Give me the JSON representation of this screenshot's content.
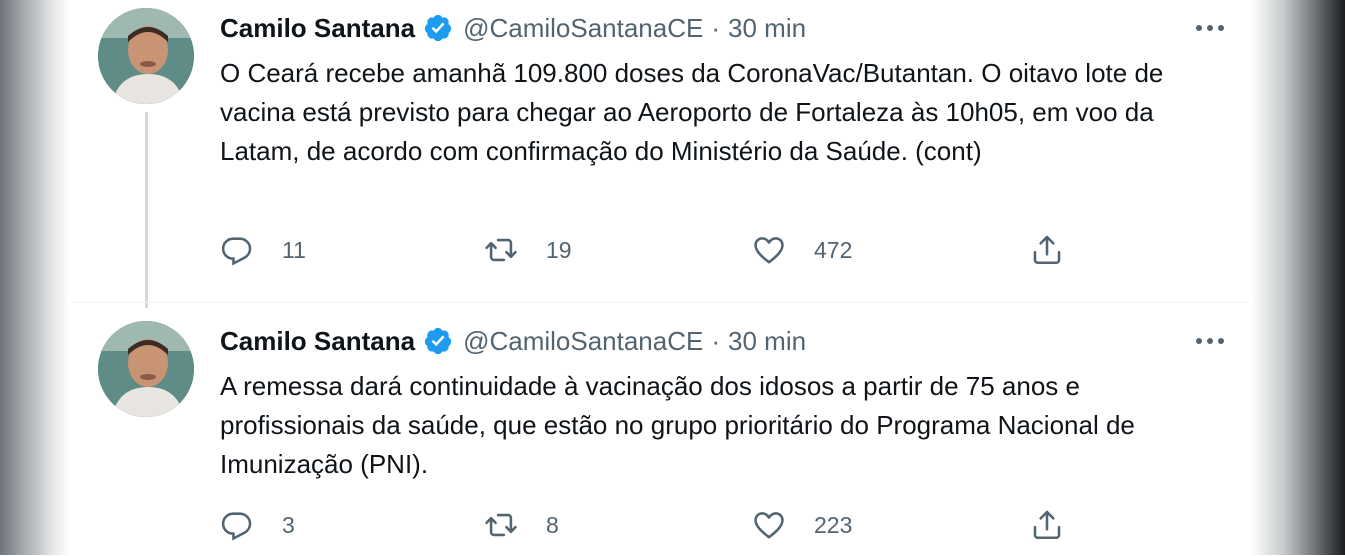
{
  "tweets": [
    {
      "author_name": "Camilo Santana",
      "handle": "@CamiloSantanaCE",
      "separator": "·",
      "time": "30 min",
      "text": "O Ceará recebe amanhã 109.800 doses da CoronaVac/Butantan. O oitavo lote de vacina está previsto para chegar ao Aeroporto de Fortaleza às 10h05, em voo da Latam, de acordo com confirmação do Ministério da Saúde. (cont)",
      "replies": "11",
      "retweets": "19",
      "likes": "472"
    },
    {
      "author_name": "Camilo Santana",
      "handle": "@CamiloSantanaCE",
      "separator": "·",
      "time": "30 min",
      "text": "A remessa dará continuidade à vacinação dos idosos a partir de 75 anos e profissionais da saúde, que estão no grupo prioritário do Programa Nacional de Imunização (PNI).",
      "replies": "3",
      "retweets": "8",
      "likes": "223"
    }
  ],
  "icons": {
    "verified": "verified-badge-icon",
    "more": "more-options-icon",
    "reply": "reply-icon",
    "retweet": "retweet-icon",
    "like": "heart-icon",
    "share": "share-icon"
  },
  "colors": {
    "verified_blue": "#1d9bf0",
    "secondary_text": "#536471",
    "primary_text": "#0f1419"
  }
}
